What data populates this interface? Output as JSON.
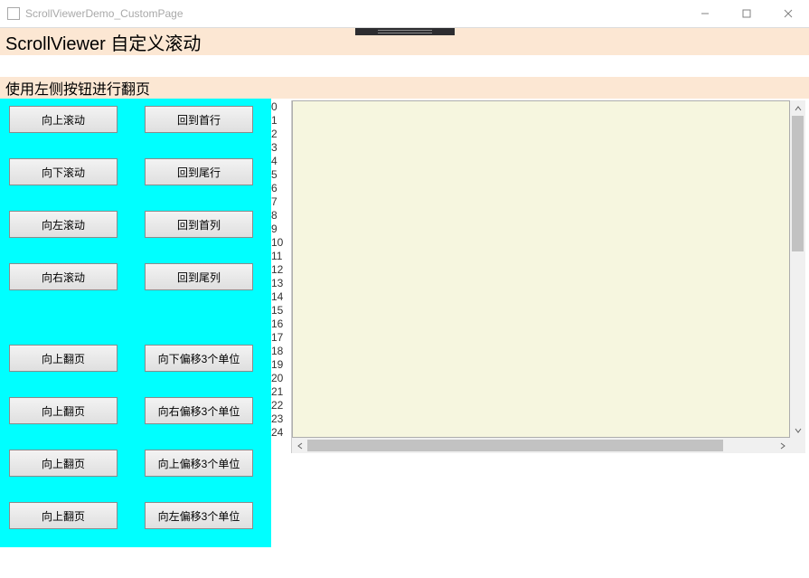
{
  "window": {
    "title": "ScrollViewerDemo_CustomPage"
  },
  "header1": "ScrollViewer 自定义滚动",
  "header2": "使用左侧按钮进行翻页",
  "buttons": {
    "left": [
      "向上滚动",
      "向下滚动",
      "向左滚动",
      "向右滚动",
      "向上翻页",
      "向上翻页",
      "向上翻页",
      "向上翻页"
    ],
    "right": [
      "回到首行",
      "回到尾行",
      "回到首列",
      "回到尾列",
      "向下偏移3个单位",
      "向右偏移3个单位",
      "向上偏移3个单位",
      "向左偏移3个单位"
    ]
  },
  "list_numbers": [
    "0",
    "1",
    "2",
    "3",
    "4",
    "5",
    "6",
    "7",
    "8",
    "9",
    "10",
    "11",
    "12",
    "13",
    "14",
    "15",
    "16",
    "17",
    "18",
    "19",
    "20",
    "21",
    "22",
    "23",
    "24"
  ]
}
